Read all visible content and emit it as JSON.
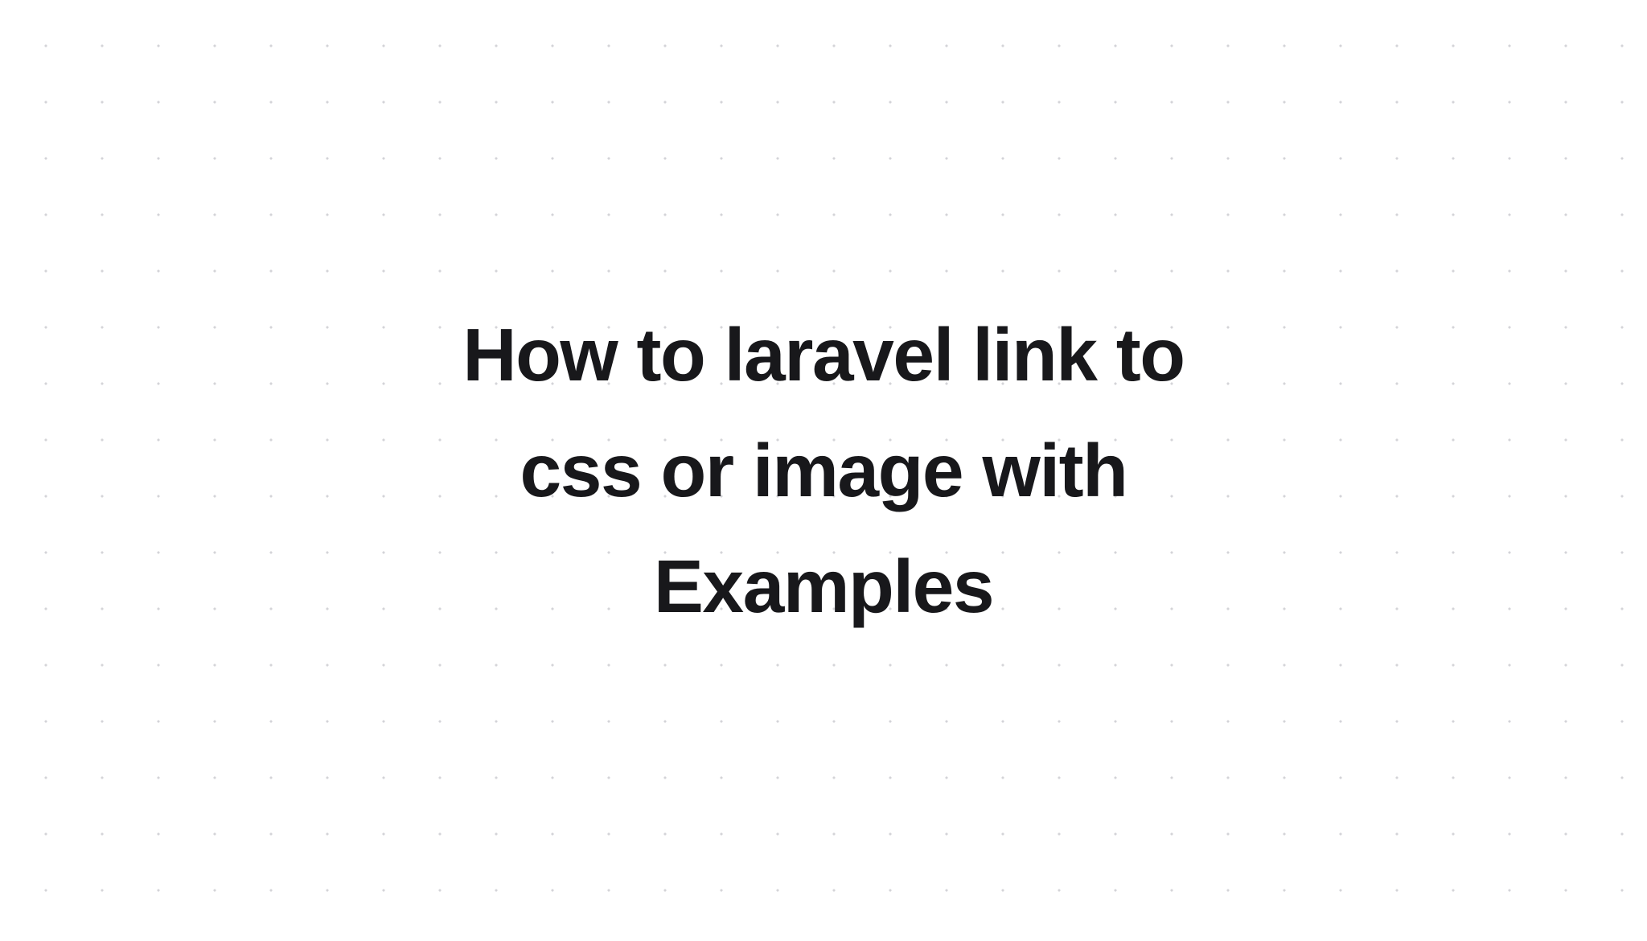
{
  "title": "How to laravel link to css or image with Examples"
}
